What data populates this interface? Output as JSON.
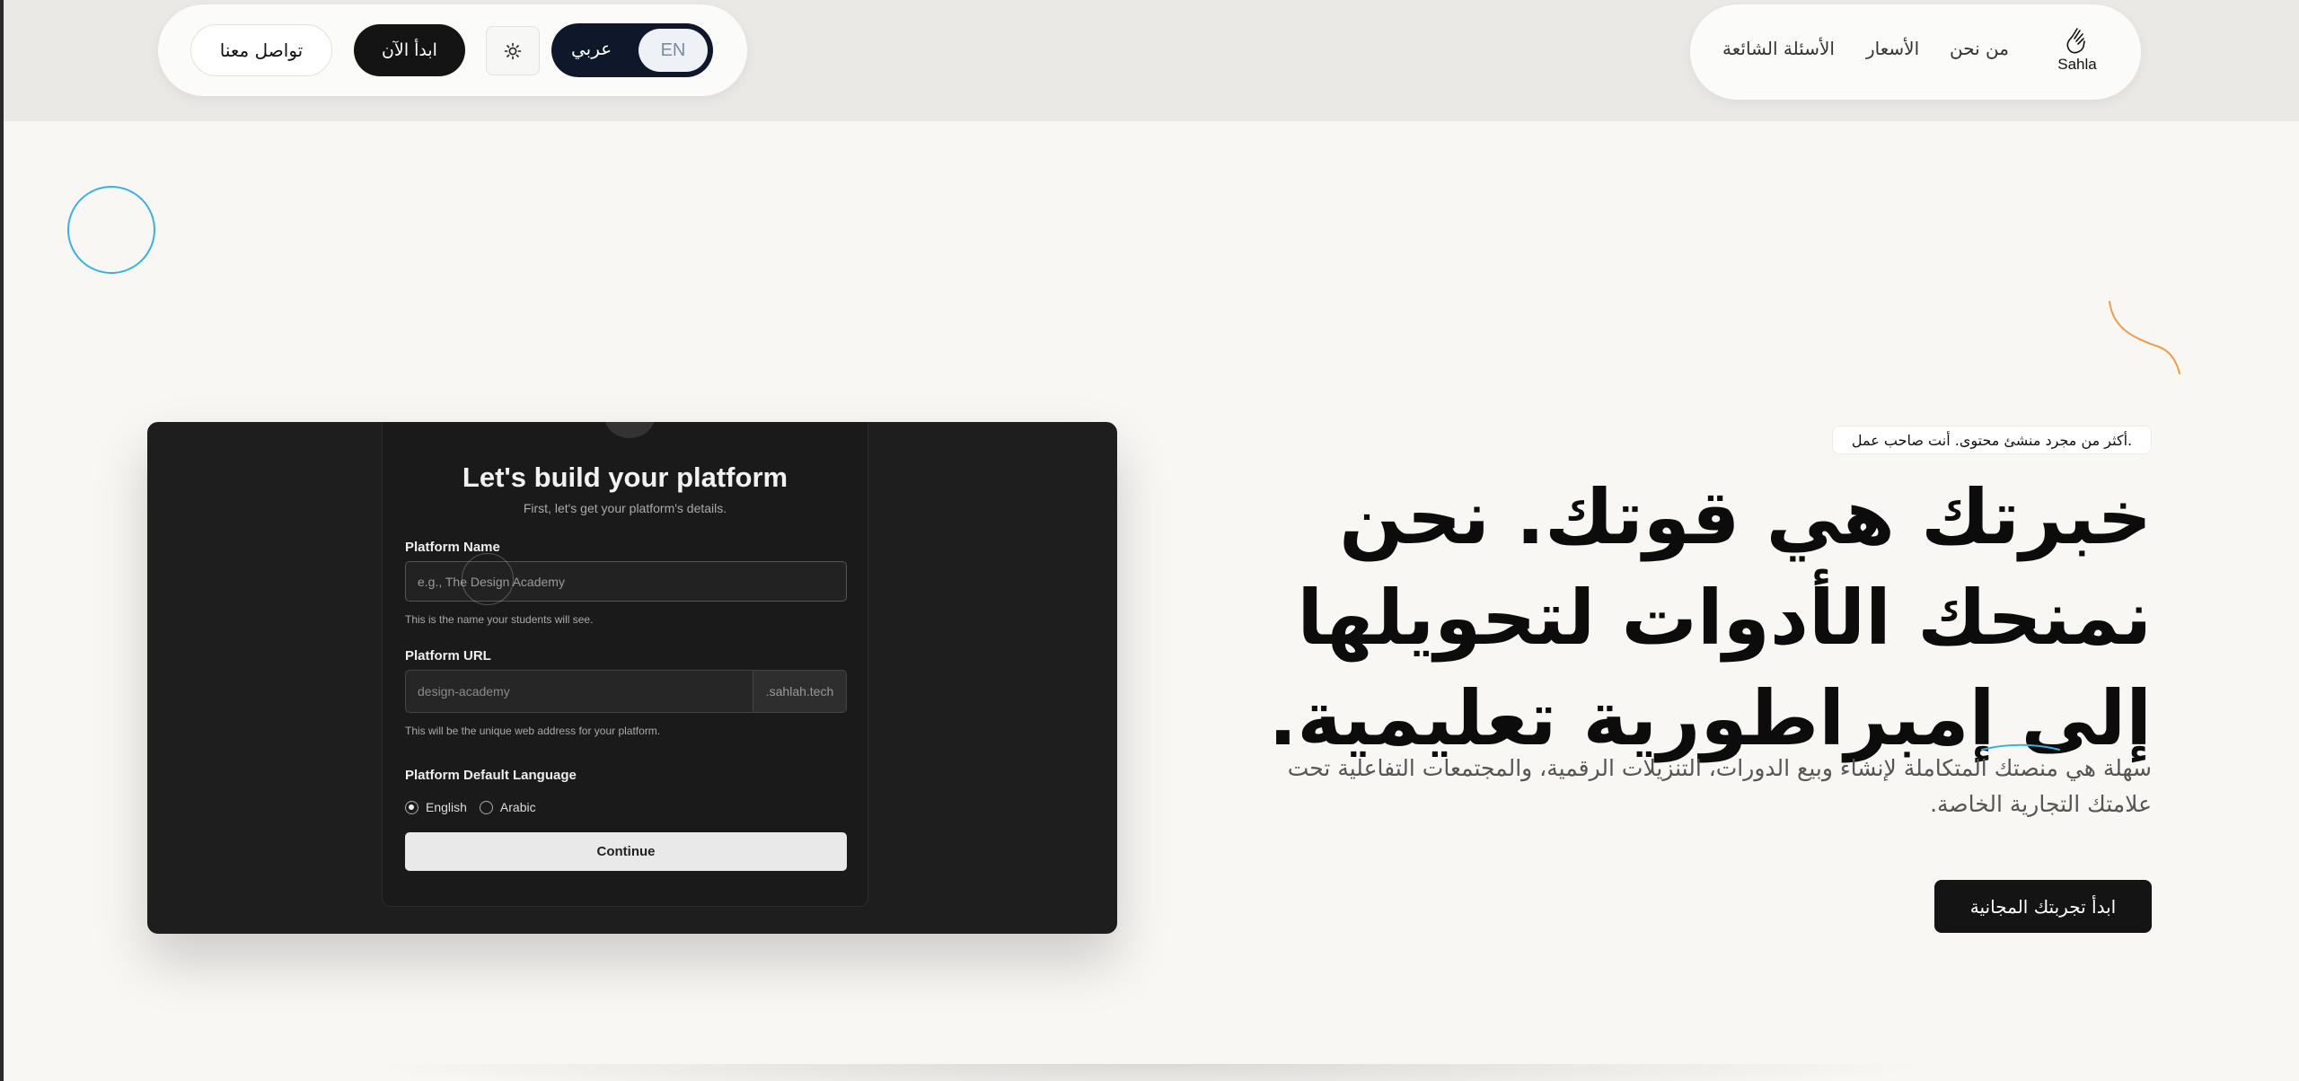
{
  "nav": {
    "logo_text": "Sahla",
    "links": [
      "من نحن",
      "الأسعار",
      "الأسئلة الشائعة"
    ]
  },
  "controls": {
    "contact_label": "تواصل معنا",
    "start_label": "ابدأ الآن",
    "lang_en": "EN",
    "lang_ar": "عربي",
    "theme_icon": "sun-icon"
  },
  "hero": {
    "tagline": "أكثر من مجرد منشئ محتوى. أنت صاحب عمل.",
    "title": "خبرتك هي قوتك. نحن نمنحك الأدوات لتحويلها إلى إمبراطورية تعليمية.",
    "subtitle": "سهلة هي منصتك المتكاملة لإنشاء وبيع الدورات، التنزيلات الرقمية، والمجتمعات التفاعلية تحت علامتك التجارية الخاصة.",
    "cta": "ابدأ تجربتك المجانية"
  },
  "mockup": {
    "title": "Let's build your platform",
    "subtitle": "First, let's get your platform's details.",
    "name_label": "Platform Name",
    "name_placeholder": "e.g., The Design Academy",
    "name_hint": "This is the name your students will see.",
    "url_label": "Platform URL",
    "url_value": "design-academy",
    "url_suffix": ".sahlah.tech",
    "url_hint": "This will be the unique web address for your platform.",
    "lang_label": "Platform Default Language",
    "lang_options": [
      "English",
      "Arabic"
    ],
    "selected_lang": "English",
    "continue": "Continue"
  },
  "colors": {
    "accent_blue": "#3bb0e0",
    "accent_orange": "#f39a4a",
    "dark": "#141414"
  }
}
